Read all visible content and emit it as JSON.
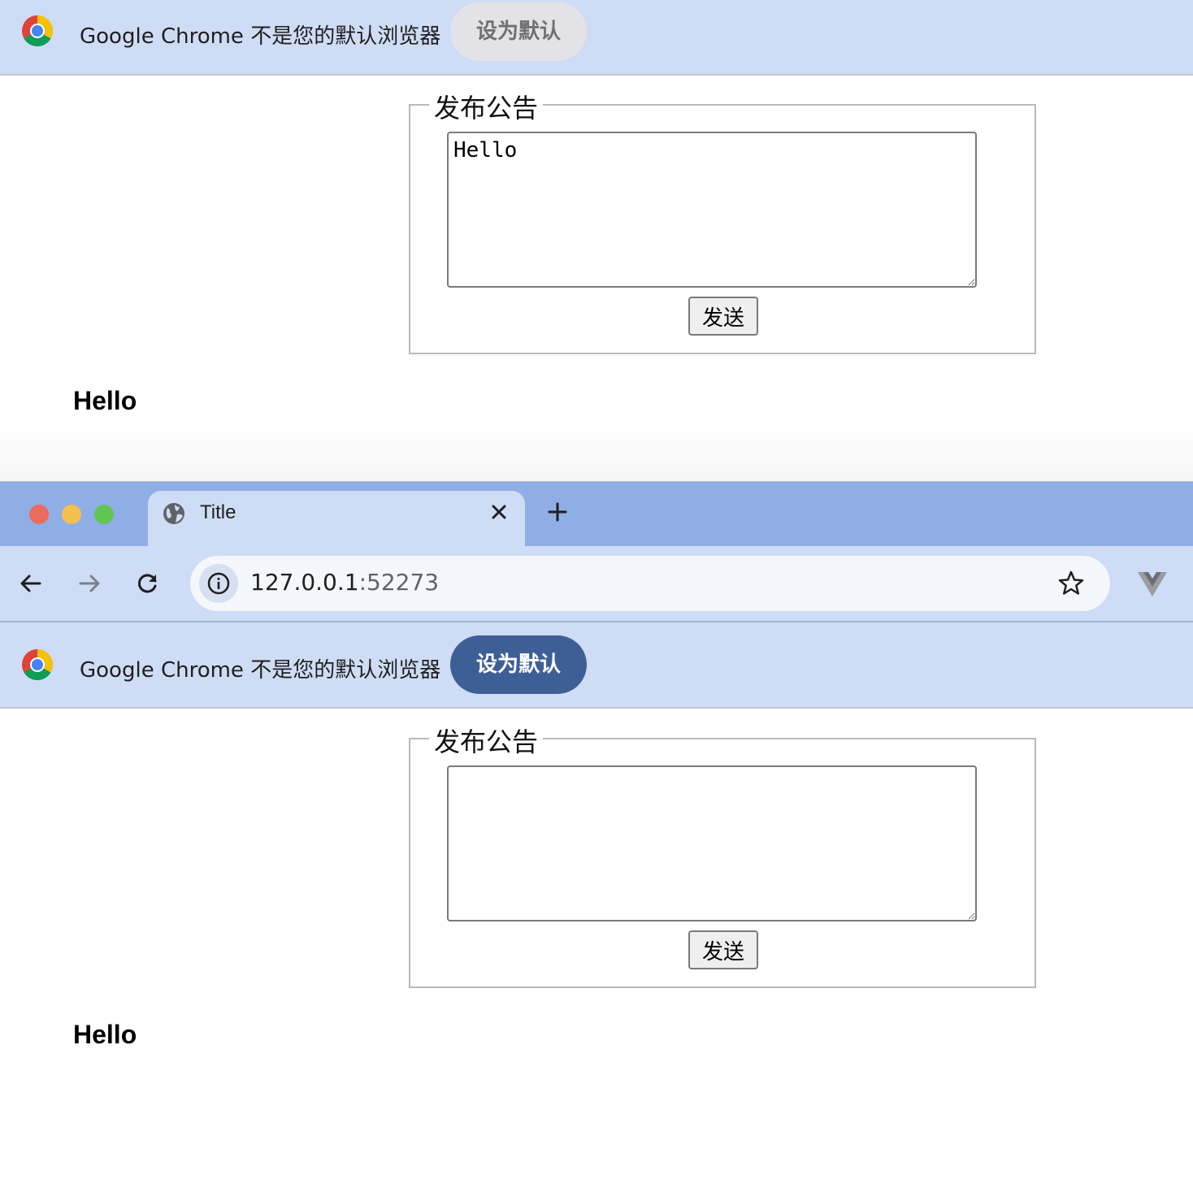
{
  "infobar": {
    "message": "Google Chrome 不是您的默认浏览器",
    "set_default_label": "设为默认"
  },
  "window": {
    "tab_title": "Title",
    "tab_close": "×",
    "new_tab": "+",
    "url_host": "127.0.0.1",
    "url_port": ":52273"
  },
  "form": {
    "legend": "发布公告",
    "send_label": "发送"
  },
  "previous_state": {
    "textarea_value": "Hello",
    "output_text": "Hello"
  },
  "current_state": {
    "textarea_value": "",
    "output_text": "Hello"
  },
  "colors": {
    "infobar_bg": "#cfdcf5",
    "tabstrip_bg": "#8eaee5",
    "primary_button": "#3e5f96"
  },
  "icons": [
    "chrome-logo-icon",
    "globe-icon",
    "close-icon",
    "plus-icon",
    "back-arrow-icon",
    "forward-arrow-icon",
    "reload-icon",
    "info-icon",
    "star-icon",
    "vue-devtools-icon"
  ]
}
